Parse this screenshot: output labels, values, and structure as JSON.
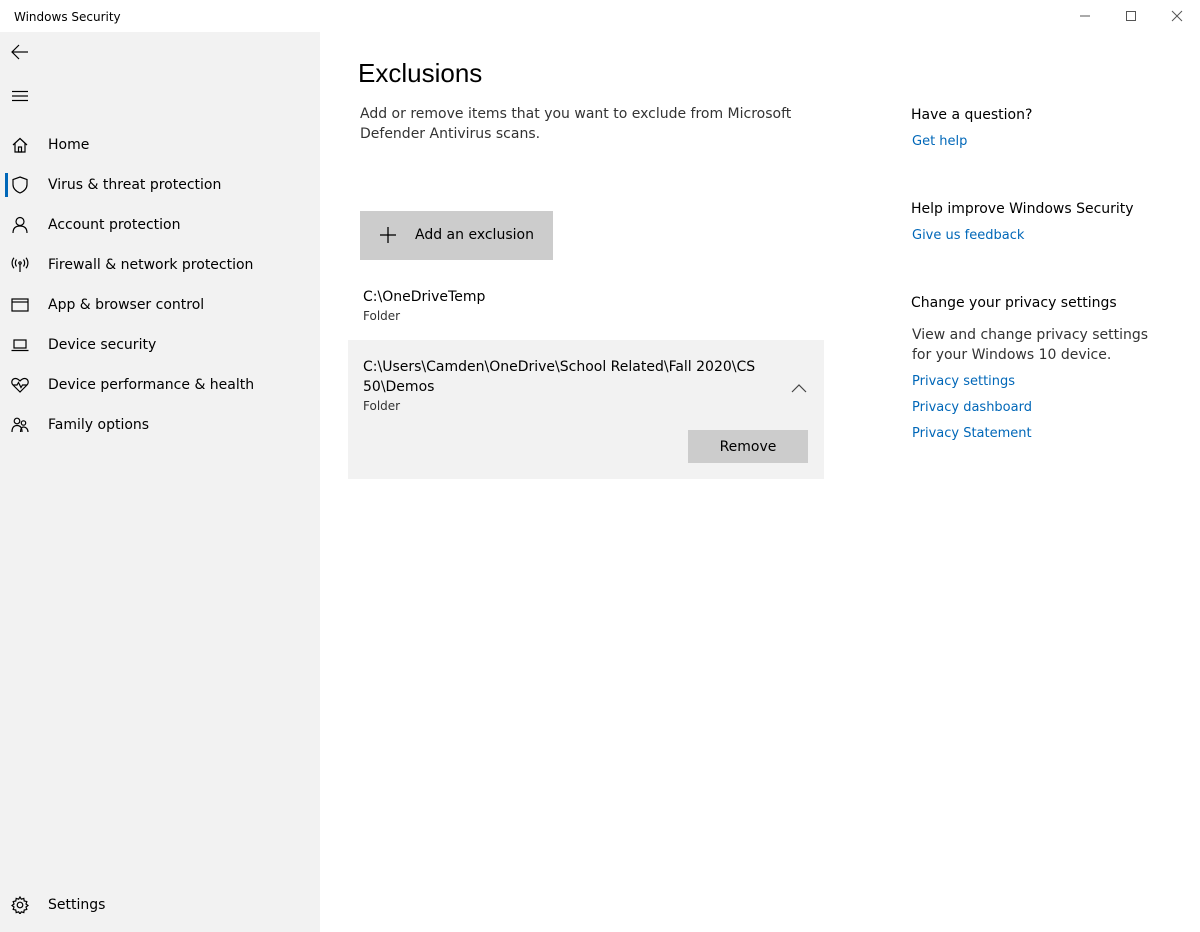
{
  "window": {
    "title": "Windows Security"
  },
  "sidebar": {
    "back_icon": "back-arrow-icon",
    "menu_icon": "hamburger-icon",
    "items": [
      {
        "label": "Home",
        "icon": "home-icon",
        "active": false
      },
      {
        "label": "Virus & threat protection",
        "icon": "shield-icon",
        "active": true
      },
      {
        "label": "Account protection",
        "icon": "person-icon",
        "active": false
      },
      {
        "label": "Firewall & network protection",
        "icon": "antenna-icon",
        "active": false
      },
      {
        "label": "App & browser control",
        "icon": "app-window-icon",
        "active": false
      },
      {
        "label": "Device security",
        "icon": "laptop-icon",
        "active": false
      },
      {
        "label": "Device performance & health",
        "icon": "heart-pulse-icon",
        "active": false
      },
      {
        "label": "Family options",
        "icon": "family-icon",
        "active": false
      }
    ],
    "settings_label": "Settings"
  },
  "main": {
    "title": "Exclusions",
    "description": "Add or remove items that you want to exclude from Microsoft Defender Antivirus scans.",
    "add_button_label": "Add an exclusion",
    "exclusions": [
      {
        "path": "C:\\OneDriveTemp",
        "type": "Folder",
        "expanded": false
      },
      {
        "path": "C:\\Users\\Camden\\OneDrive\\School Related\\Fall 2020\\CS 50\\Demos",
        "type": "Folder",
        "expanded": true
      }
    ],
    "remove_button_label": "Remove"
  },
  "right_panel": {
    "question_heading": "Have a question?",
    "get_help_link": "Get help",
    "improve_heading": "Help improve Windows Security",
    "feedback_link": "Give us feedback",
    "privacy_heading": "Change your privacy settings",
    "privacy_text": "View and change privacy settings for your Windows 10 device.",
    "privacy_settings_link": "Privacy settings",
    "privacy_dashboard_link": "Privacy dashboard",
    "privacy_statement_link": "Privacy Statement"
  },
  "colors": {
    "accent": "#0067b8",
    "sidebar_bg": "#f2f2f2",
    "button_bg": "#cccccc"
  }
}
